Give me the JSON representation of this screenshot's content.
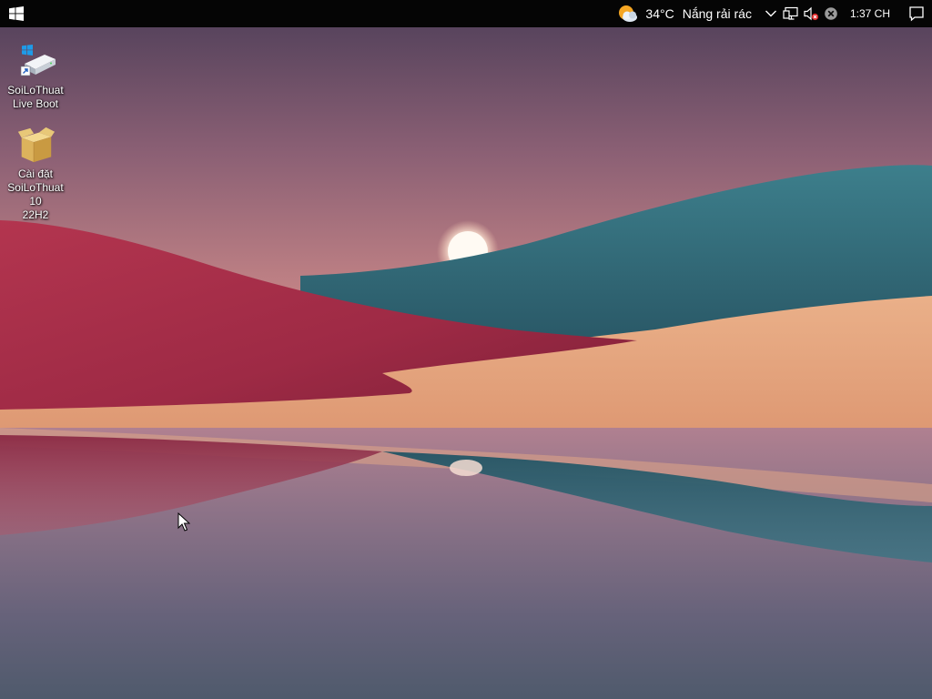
{
  "taskbar": {
    "start_icon": "windows-logo-icon",
    "weather": {
      "icon": "partly-sunny-icon",
      "temperature": "34°C",
      "condition": "Nắng rải rác"
    },
    "tray": {
      "overflow_icon": "chevron-up-icon",
      "network_icon": "network-icon",
      "volume_icon": "volume-muted-icon",
      "status_icon": "close-circle-icon"
    },
    "clock": "1:37 CH",
    "notification_icon": "notification-icon"
  },
  "desktop": {
    "icons": [
      {
        "label": "SoiLoThuat\nLive Boot",
        "icon": "drive-shortcut-icon"
      },
      {
        "label": "Cài đặt\nSoiLoThuat 10\n22H2",
        "icon": "package-box-icon"
      }
    ]
  },
  "colors": {
    "taskbar": "#050505",
    "sky_top": "#5e4a64",
    "sky_horizon": "#d89a8c",
    "red_hill": "#a42d48",
    "forest": "#2f6a78",
    "sand": "#e39d72",
    "water": "#6a5c72"
  }
}
